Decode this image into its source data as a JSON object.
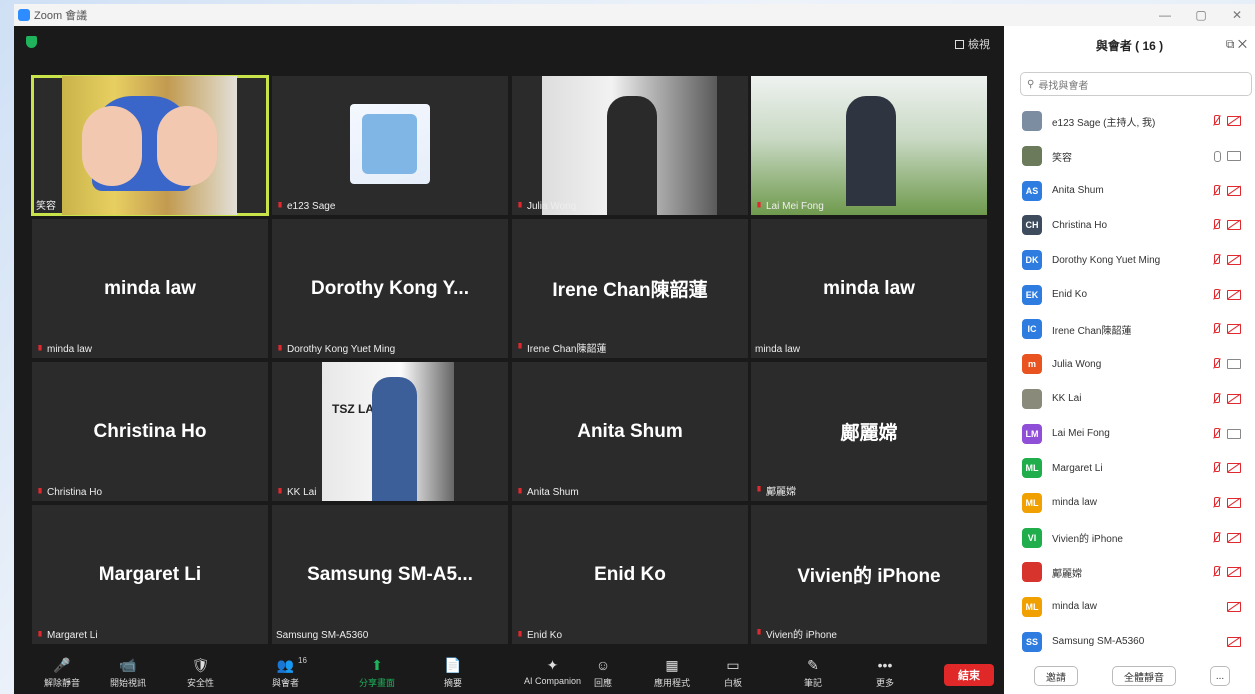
{
  "window": {
    "title": "Zoom 會議",
    "controls": [
      "—",
      "▢",
      "✕"
    ]
  },
  "view_label": "檢視",
  "tiles": [
    {
      "big": "",
      "name": "笑容",
      "muted": false,
      "active": true,
      "type": "video"
    },
    {
      "big": "",
      "name": "e123 Sage",
      "muted": true,
      "type": "video"
    },
    {
      "big": "",
      "name": "Julia Wong",
      "muted": true,
      "type": "video"
    },
    {
      "big": "",
      "name": "Lai Mei Fong",
      "muted": true,
      "type": "video"
    },
    {
      "big": "minda law",
      "name": "minda law",
      "muted": true
    },
    {
      "big": "Dorothy Kong Y...",
      "name": "Dorothy Kong Yuet Ming",
      "muted": true
    },
    {
      "big": "Irene  Chan陳韶蓮",
      "name": "Irene Chan陳韶蓮",
      "muted": true
    },
    {
      "big": "minda law",
      "name": "minda law",
      "muted": false
    },
    {
      "big": "Christina Ho",
      "name": "Christina Ho",
      "muted": true
    },
    {
      "big": "",
      "name": "KK Lai",
      "muted": true,
      "type": "video"
    },
    {
      "big": "Anita Shum",
      "name": "Anita Shum",
      "muted": true
    },
    {
      "big": "鄺麗嫦",
      "name": "鄺麗嫦",
      "muted": true
    },
    {
      "big": "Margaret Li",
      "name": "Margaret Li",
      "muted": true
    },
    {
      "big": "Samsung  SM-A5...",
      "name": "Samsung SM-A5360",
      "muted": false
    },
    {
      "big": "Enid Ko",
      "name": "Enid Ko",
      "muted": true
    },
    {
      "big": "Vivien的 iPhone",
      "name": "Vivien的 iPhone",
      "muted": true
    }
  ],
  "panel": {
    "title": "與會者 ( 16 )",
    "search_placeholder": "尋找與會者",
    "participants": [
      {
        "name": "e123 Sage (主持人, 我)",
        "initials": "",
        "color": "#7d8da1",
        "mic": "muted",
        "cam": "off"
      },
      {
        "name": "笑容",
        "initials": "",
        "color": "#6b7a5a",
        "mic": "on",
        "cam": "on"
      },
      {
        "name": "Anita Shum",
        "initials": "AS",
        "color": "#2e7ce0",
        "mic": "muted",
        "cam": "off"
      },
      {
        "name": "Christina Ho",
        "initials": "CH",
        "color": "#3d4b5c",
        "mic": "muted",
        "cam": "off"
      },
      {
        "name": "Dorothy Kong Yuet Ming",
        "initials": "DK",
        "color": "#2e7ce0",
        "mic": "muted",
        "cam": "off"
      },
      {
        "name": "Enid Ko",
        "initials": "EK",
        "color": "#2e7ce0",
        "mic": "muted",
        "cam": "off"
      },
      {
        "name": "Irene Chan陳韶蓮",
        "initials": "IC",
        "color": "#2e7ce0",
        "mic": "muted",
        "cam": "off"
      },
      {
        "name": "Julia Wong",
        "initials": "m",
        "color": "#e8531f",
        "mic": "muted",
        "cam": "on"
      },
      {
        "name": "KK Lai",
        "initials": "",
        "color": "#8a8a7a",
        "mic": "muted",
        "cam": "off"
      },
      {
        "name": "Lai Mei Fong",
        "initials": "LM",
        "color": "#8f4fd6",
        "mic": "muted",
        "cam": "on"
      },
      {
        "name": "Margaret Li",
        "initials": "ML",
        "color": "#1fae4b",
        "mic": "muted",
        "cam": "off"
      },
      {
        "name": "minda law",
        "initials": "ML",
        "color": "#f0a000",
        "mic": "muted",
        "cam": "off"
      },
      {
        "name": "Vivien的 iPhone",
        "initials": "VI",
        "color": "#1fae4b",
        "mic": "muted",
        "cam": "off"
      },
      {
        "name": "鄺麗嫦",
        "initials": "",
        "color": "#d6342c",
        "mic": "muted",
        "cam": "off"
      },
      {
        "name": "minda law",
        "initials": "ML",
        "color": "#f0a000",
        "mic": "none",
        "cam": "off"
      },
      {
        "name": "Samsung SM-A5360",
        "initials": "SS",
        "color": "#2e7ce0",
        "mic": "none",
        "cam": "off"
      }
    ],
    "footer": {
      "invite": "邀請",
      "mute_all": "全體靜音",
      "more": "..."
    }
  },
  "toolbar": {
    "items": [
      {
        "label": "解除靜音",
        "icon": "🎤"
      },
      {
        "label": "開始視訊",
        "icon": "📹"
      },
      {
        "label": "安全性",
        "icon": "🛡"
      },
      {
        "label": "與會者",
        "icon": "👥",
        "count": "16"
      },
      {
        "label": "分享畫面",
        "icon": "⬆"
      },
      {
        "label": "摘要",
        "icon": "📄"
      },
      {
        "label": "AI Companion",
        "icon": "✦"
      },
      {
        "label": "回應",
        "icon": "☺"
      },
      {
        "label": "應用程式",
        "icon": "▦"
      },
      {
        "label": "白板",
        "icon": "▭"
      },
      {
        "label": "筆記",
        "icon": "✎"
      },
      {
        "label": "更多",
        "icon": "•••"
      }
    ],
    "end": "結束"
  }
}
